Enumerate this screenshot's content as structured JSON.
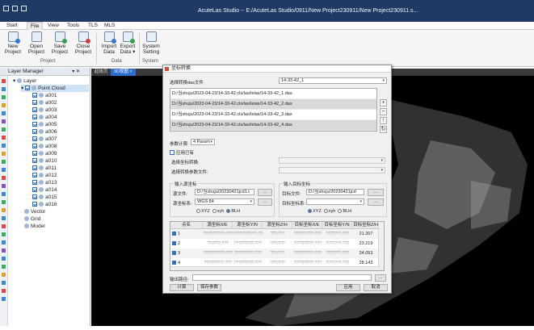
{
  "window": {
    "title": "AcuteLas Studio -- E:/AcuteLas Studio/0911/New Project230911/New Project230911.s..."
  },
  "menu": [
    "Start",
    "File",
    "View",
    "Tools",
    "TLS",
    "MLS"
  ],
  "ribbon": {
    "buttons": [
      {
        "label1": "New",
        "label2": "Project"
      },
      {
        "label1": "Open",
        "label2": "Project"
      },
      {
        "label1": "Save",
        "label2": "Project"
      },
      {
        "label1": "Close",
        "label2": "Project"
      },
      {
        "label1": "Import",
        "label2": "Data"
      },
      {
        "label1": "Export",
        "label2": "Data ▾"
      },
      {
        "label1": "System",
        "label2": "Setting"
      }
    ],
    "groups": [
      "Project",
      "Data",
      "System"
    ]
  },
  "layer_manager": {
    "title": "Layer Manager",
    "pin": "▾ ✕",
    "root": "Layer",
    "point_cloud": "Point Cloud",
    "items": [
      "a001",
      "a002",
      "a003",
      "a004",
      "a005",
      "a006",
      "a007",
      "a008",
      "a009",
      "a010",
      "a011",
      "a012",
      "a013",
      "a014",
      "a015",
      "a016"
    ],
    "vector": "Vector",
    "grid": "Grid",
    "model": "Model"
  },
  "viewport": {
    "tabs": [
      "起始页",
      "3D视图 ×"
    ]
  },
  "dialog": {
    "title": "坐标转换",
    "select_files_label": "选择转换das文件",
    "file_combo": "14-33-42_1",
    "files": [
      "D:/当shuju/2023-04-23/14-33-42.cls/las/lelas/14-33-42_1.das",
      "D:/当shuju/2023-04-23/14-33-42.cls/las/lelas/14-33-42_2.das",
      "D:/当shuju/2023-04-23/14-33-42.cls/las/lelas/14-33-42_3.das",
      "D:/当shuju/2023-04-23/14-33-42.cls/las/lelas/14-33-42_4.das"
    ],
    "side_buttons": [
      "+",
      "−",
      "↑",
      "↻"
    ],
    "param_count_label": "参数计算:",
    "param_count_value": "4 Param",
    "use_existing_label": "应用已有",
    "select_src_label": "选择坐标转换:",
    "select_dst_label": "选择转换参数文件:",
    "input_group": "输入源坐标",
    "output_group": "输入目标坐标",
    "src_file_label": "源文件:",
    "src_file_value": "D:/当shuju/20230421jcd1.t",
    "src_sys_label": "源坐标系:",
    "src_sys_value": "WGS 84",
    "dst_file_label": "目标文件:",
    "dst_file_value": "D:/当shuju/20230421jcd",
    "dst_sys_label": "目标坐标系:",
    "browse": "...",
    "radio_xyz": "XYZ",
    "radio_xyh": "xyh",
    "radio_blh": "BLH",
    "table_headers": [
      "点名",
      "源坐标X/E",
      "源坐标Y/N",
      "源坐标Z/H",
      "目标坐标X/E",
      "目标坐标Y/N",
      "目标坐标Z/H"
    ],
    "table_rows": [
      {
        "idx": "1",
        "c1": "??????????.???",
        "c2": "???????????.??",
        "c3": "???.???",
        "c4": "?????????.???",
        "c5": "???????.???",
        "z": "21.207"
      },
      {
        "idx": "2",
        "c1": "??????.???",
        "c2": "?????????.???",
        "c3": "???.???",
        "c4": "?????????.???",
        "c5": "???????.???",
        "z": "23.219"
      },
      {
        "idx": "3",
        "c1": "??????????.???",
        "c2": "?????????.???",
        "c3": "???.???",
        "c4": "?????????.???",
        "c5": "???????.???",
        "z": "24.053"
      },
      {
        "idx": "4",
        "c1": "?????????.???",
        "c2": "?????????.???",
        "c3": "???.???",
        "c4": "?????????.???",
        "c5": "???????.???",
        "z": "28.143"
      }
    ],
    "output_path_label": "输出路径:",
    "btn_calc": "计算",
    "btn_save": "保存参数",
    "btn_apply": "应用",
    "btn_cancel": "取消"
  },
  "colors": {
    "titlebar": "#1f3a64",
    "accent": "#2c6fd1"
  }
}
